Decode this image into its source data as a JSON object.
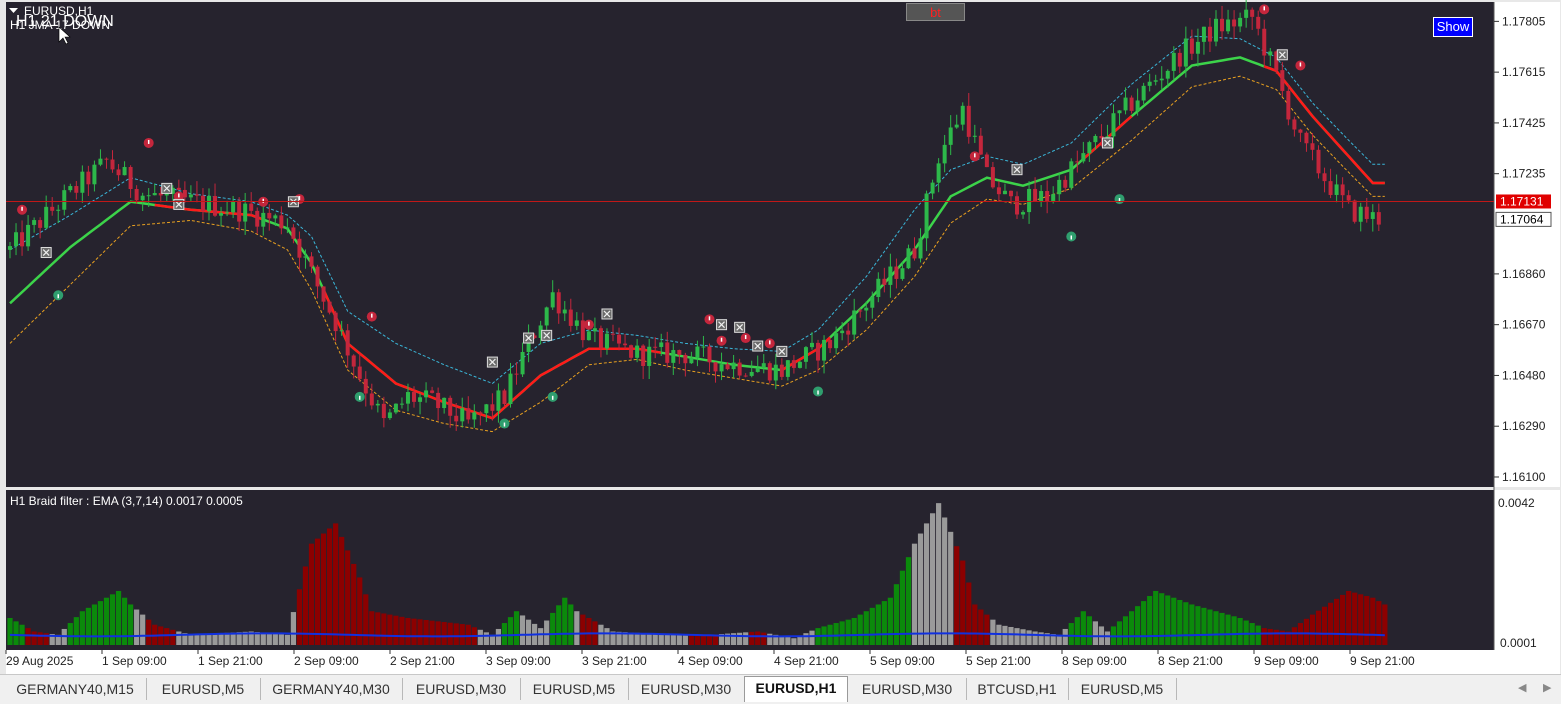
{
  "symbol_title": "EURUSD,H1",
  "ma_label": "H1 JMA 17 DOWN",
  "overlay_text": "H1 21 DOWN",
  "show_button": "Show",
  "bt_button": "bt",
  "indicator_title": "H1 Braid filter : EMA  (3,7,14) 0.0017 0.0005",
  "colors": {
    "background": "#26232e",
    "bull": "#2db84a",
    "bear": "#c4263c",
    "ma_up": "#3cd34a",
    "ma_down": "#ff1a1a",
    "band_upper": "#3ab6d8",
    "band_lower": "#e8a020",
    "hist_bull": "#0b8a0b",
    "hist_bear": "#8c0000",
    "hist_neutral": "#9a9a9a",
    "signal_line": "#1030e0"
  },
  "chart_data": [
    {
      "type": "candlestick",
      "price_axis_ticks": [
        "1.17805",
        "1.17615",
        "1.17425",
        "1.17235",
        "1.16860",
        "1.16670",
        "1.16480",
        "1.16290",
        "1.16100"
      ],
      "ylim": [
        1.1607,
        1.1787
      ],
      "price_labels": {
        "bid": "1.17131",
        "last": "1.17064"
      },
      "time_labels": [
        "29 Aug 2025",
        "1 Sep 09:00",
        "1 Sep 21:00",
        "2 Sep 09:00",
        "2 Sep 21:00",
        "3 Sep 09:00",
        "3 Sep 21:00",
        "4 Sep 09:00",
        "4 Sep 21:00",
        "5 Sep 09:00",
        "5 Sep 21:00",
        "8 Sep 09:00",
        "8 Sep 21:00",
        "9 Sep 09:00",
        "9 Sep 21:00"
      ],
      "anchor_closes": [
        [
          0,
          1.1695
        ],
        [
          8,
          1.1712
        ],
        [
          16,
          1.1728
        ],
        [
          22,
          1.1716
        ],
        [
          30,
          1.1713
        ],
        [
          38,
          1.171
        ],
        [
          46,
          1.1705
        ],
        [
          50,
          1.1686
        ],
        [
          54,
          1.1668
        ],
        [
          58,
          1.1648
        ],
        [
          62,
          1.163
        ],
        [
          66,
          1.164
        ],
        [
          70,
          1.1638
        ],
        [
          76,
          1.163
        ],
        [
          82,
          1.164
        ],
        [
          86,
          1.166
        ],
        [
          90,
          1.1678
        ],
        [
          96,
          1.1662
        ],
        [
          104,
          1.1656
        ],
        [
          112,
          1.1656
        ],
        [
          120,
          1.1652
        ],
        [
          128,
          1.165
        ],
        [
          136,
          1.166
        ],
        [
          144,
          1.168
        ],
        [
          150,
          1.1695
        ],
        [
          154,
          1.173
        ],
        [
          158,
          1.1748
        ],
        [
          162,
          1.1722
        ],
        [
          166,
          1.1712
        ],
        [
          172,
          1.1715
        ],
        [
          180,
          1.1735
        ],
        [
          186,
          1.175
        ],
        [
          194,
          1.1768
        ],
        [
          200,
          1.1778
        ],
        [
          206,
          1.1782
        ],
        [
          210,
          1.176
        ],
        [
          214,
          1.1735
        ],
        [
          218,
          1.1722
        ],
        [
          222,
          1.171
        ],
        [
          226,
          1.1707
        ]
      ],
      "bands": [
        [
          0,
          1.1675,
          1.1695,
          1.166
        ],
        [
          10,
          1.1696,
          1.1708,
          1.1682
        ],
        [
          20,
          1.1713,
          1.1722,
          1.1704
        ],
        [
          30,
          1.171,
          1.1716,
          1.1706
        ],
        [
          40,
          1.1708,
          1.1713,
          1.1702
        ],
        [
          46,
          1.1703,
          1.1708,
          1.1695
        ],
        [
          50,
          1.169,
          1.17,
          1.168
        ],
        [
          56,
          1.166,
          1.1672,
          1.165
        ],
        [
          64,
          1.1645,
          1.166,
          1.1635
        ],
        [
          72,
          1.1638,
          1.1652,
          1.163
        ],
        [
          80,
          1.1632,
          1.1645,
          1.1627
        ],
        [
          88,
          1.1648,
          1.166,
          1.1638
        ],
        [
          96,
          1.1658,
          1.1665,
          1.1652
        ],
        [
          104,
          1.1658,
          1.1663,
          1.1654
        ],
        [
          112,
          1.1655,
          1.166,
          1.165
        ],
        [
          120,
          1.1652,
          1.1658,
          1.1647
        ],
        [
          128,
          1.165,
          1.1657,
          1.1644
        ],
        [
          134,
          1.1658,
          1.1665,
          1.165
        ],
        [
          142,
          1.1675,
          1.1685,
          1.1665
        ],
        [
          150,
          1.1695,
          1.171,
          1.1685
        ],
        [
          156,
          1.1715,
          1.1725,
          1.1705
        ],
        [
          162,
          1.1722,
          1.173,
          1.1714
        ],
        [
          168,
          1.1719,
          1.1727,
          1.1712
        ],
        [
          176,
          1.1725,
          1.1735,
          1.1718
        ],
        [
          186,
          1.1745,
          1.1757,
          1.1736
        ],
        [
          196,
          1.1764,
          1.1775,
          1.1756
        ],
        [
          204,
          1.1767,
          1.1774,
          1.176
        ],
        [
          210,
          1.1762,
          1.1767,
          1.1755
        ],
        [
          216,
          1.1745,
          1.175,
          1.1738
        ],
        [
          222,
          1.173,
          1.1736,
          1.1724
        ],
        [
          226,
          1.172,
          1.1727,
          1.1715
        ]
      ],
      "ma_down_segments": [
        [
          24,
          42
        ],
        [
          52,
          108
        ],
        [
          128,
          136
        ],
        [
          178,
          186
        ],
        [
          208,
          228
        ]
      ],
      "signals_sell": [
        [
          2,
          1.171
        ],
        [
          23,
          1.1735
        ],
        [
          28,
          1.1715
        ],
        [
          42,
          1.1713
        ],
        [
          48,
          1.1714
        ],
        [
          60,
          1.167
        ],
        [
          96,
          1.1667
        ],
        [
          116,
          1.1669
        ],
        [
          118,
          1.1661
        ],
        [
          122,
          1.1662
        ],
        [
          126,
          1.166
        ],
        [
          160,
          1.173
        ],
        [
          208,
          1.1785
        ],
        [
          214,
          1.1764
        ]
      ],
      "signals_buy": [
        [
          8,
          1.1678
        ],
        [
          58,
          1.164
        ],
        [
          82,
          1.163
        ],
        [
          90,
          1.164
        ],
        [
          134,
          1.1642
        ],
        [
          176,
          1.17
        ],
        [
          184,
          1.1714
        ]
      ],
      "signals_exit": [
        [
          6,
          1.1694
        ],
        [
          26,
          1.1718
        ],
        [
          28,
          1.1712
        ],
        [
          47,
          1.1713
        ],
        [
          80,
          1.1653
        ],
        [
          86,
          1.1662
        ],
        [
          89,
          1.1663
        ],
        [
          99,
          1.1671
        ],
        [
          118,
          1.1667
        ],
        [
          121,
          1.1666
        ],
        [
          124,
          1.1659
        ],
        [
          128,
          1.1657
        ],
        [
          167,
          1.1725
        ],
        [
          182,
          1.1735
        ],
        [
          211,
          1.1768
        ]
      ]
    },
    {
      "type": "histogram",
      "axis_ticks": [
        "0.0042",
        "0.0001"
      ],
      "ylim": [
        0,
        0.0045
      ],
      "bull_runs": [
        [
          0,
          2
        ],
        [
          10,
          20
        ],
        [
          82,
          84
        ],
        [
          90,
          93
        ],
        [
          134,
          149
        ],
        [
          176,
          179
        ],
        [
          183,
          205
        ],
        [
          206,
          207
        ]
      ],
      "bear_runs": [
        [
          3,
          6
        ],
        [
          23,
          27
        ],
        [
          48,
          58
        ],
        [
          59,
          77
        ],
        [
          95,
          97
        ],
        [
          113,
          117
        ],
        [
          123,
          125
        ],
        [
          157,
          162
        ],
        [
          208,
          228
        ]
      ],
      "sample_levels": [
        [
          0,
          0.0008
        ],
        [
          2,
          0.0006
        ],
        [
          4,
          0.0004
        ],
        [
          8,
          0.0003
        ],
        [
          12,
          0.001
        ],
        [
          18,
          0.0016
        ],
        [
          20,
          0.0012
        ],
        [
          24,
          0.0006
        ],
        [
          30,
          0.0003
        ],
        [
          40,
          0.0004
        ],
        [
          46,
          0.0003
        ],
        [
          50,
          0.003
        ],
        [
          54,
          0.0036
        ],
        [
          58,
          0.002
        ],
        [
          60,
          0.001
        ],
        [
          66,
          0.0008
        ],
        [
          76,
          0.0006
        ],
        [
          80,
          0.0003
        ],
        [
          84,
          0.001
        ],
        [
          88,
          0.0005
        ],
        [
          92,
          0.0014
        ],
        [
          94,
          0.001
        ],
        [
          100,
          0.0004
        ],
        [
          110,
          0.0003
        ],
        [
          116,
          0.0003
        ],
        [
          124,
          0.0004
        ],
        [
          130,
          0.0002
        ],
        [
          134,
          0.0005
        ],
        [
          140,
          0.0008
        ],
        [
          146,
          0.0014
        ],
        [
          150,
          0.003
        ],
        [
          154,
          0.0042
        ],
        [
          158,
          0.0025
        ],
        [
          160,
          0.0012
        ],
        [
          164,
          0.0006
        ],
        [
          170,
          0.0004
        ],
        [
          174,
          0.0003
        ],
        [
          178,
          0.001
        ],
        [
          182,
          0.0004
        ],
        [
          186,
          0.001
        ],
        [
          190,
          0.0016
        ],
        [
          196,
          0.0012
        ],
        [
          204,
          0.0008
        ],
        [
          208,
          0.0005
        ],
        [
          212,
          0.0004
        ],
        [
          216,
          0.0009
        ],
        [
          222,
          0.0016
        ],
        [
          226,
          0.0014
        ],
        [
          228,
          0.0012
        ]
      ],
      "signal_line_level": 0.0003
    }
  ]
}
